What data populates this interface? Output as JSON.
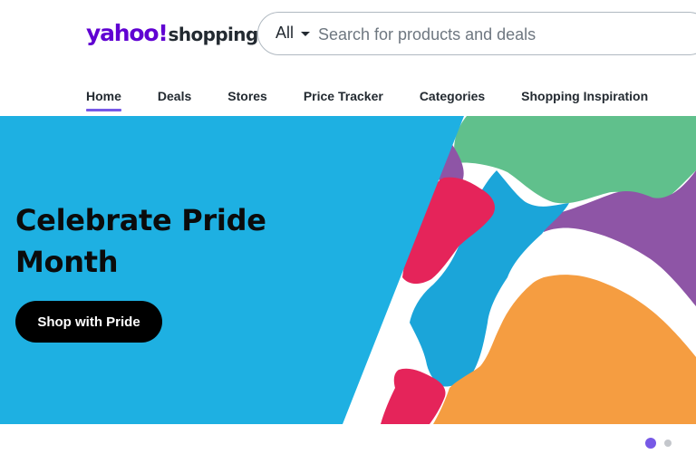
{
  "header": {
    "logo": {
      "yahoo": "yahoo!",
      "shopping": "shopping"
    },
    "search": {
      "scope": "All",
      "placeholder": "Search for products and deals"
    }
  },
  "nav": {
    "items": [
      {
        "label": "Home",
        "active": true
      },
      {
        "label": "Deals"
      },
      {
        "label": "Stores"
      },
      {
        "label": "Price Tracker"
      },
      {
        "label": "Categories"
      },
      {
        "label": "Shopping Inspiration"
      }
    ]
  },
  "hero": {
    "title": "Celebrate Pride Month",
    "button_label": "Shop with Pride",
    "colors": {
      "panel": "#1eb0e2",
      "green": "#60c08c",
      "purple": "#8e55a6",
      "pink": "#e5245a",
      "blue": "#1ba5d9",
      "orange": "#f59d41",
      "white": "#ffffff"
    }
  },
  "carousel": {
    "slide_count": 2,
    "active_index": 0
  },
  "colors": {
    "brand": "#6001d2",
    "accent": "#7759e6",
    "text": "#232a31"
  }
}
